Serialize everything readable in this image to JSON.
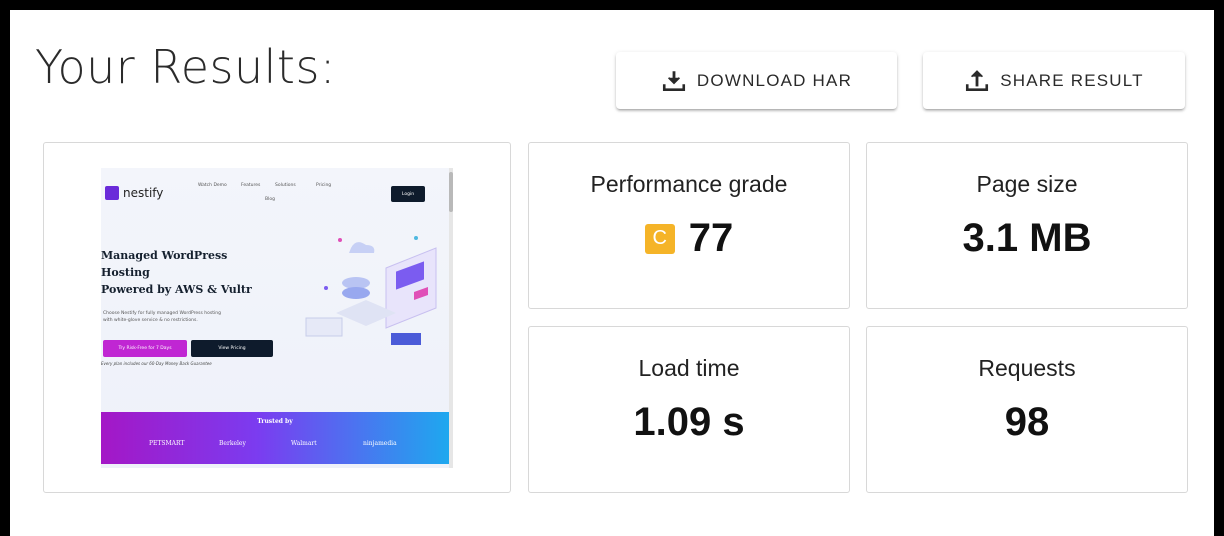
{
  "title": "Your Results:",
  "buttons": {
    "download_label": "DOWNLOAD HAR",
    "share_label": "SHARE RESULT"
  },
  "metrics": {
    "performance": {
      "label": "Performance grade",
      "grade": "C",
      "score": "77",
      "grade_color": "#f5b428"
    },
    "page_size": {
      "label": "Page size",
      "value": "3.1 MB"
    },
    "load_time": {
      "label": "Load time",
      "value": "1.09 s"
    },
    "requests": {
      "label": "Requests",
      "value": "98"
    }
  },
  "screenshot": {
    "logo": "nestify",
    "nav": [
      "Watch Demo",
      "Features",
      "Solutions",
      "Pricing",
      "Blog"
    ],
    "login": "Login",
    "headline": [
      "Managed WordPress",
      "Hosting",
      "Powered by AWS & Vultr"
    ],
    "sub": [
      "Choose Nestify for fully managed WordPress hosting",
      "with white-glove service & no restrictions."
    ],
    "cta_primary": "Try Risk-Free for 7 Days",
    "cta_secondary": "View Pricing",
    "note": "Every plan includes our 60-Day Money Back Guarantee",
    "trusted": "Trusted by",
    "brands": [
      "PETSMART",
      "Berkeley",
      "Walmart",
      "ninjamedia"
    ]
  }
}
